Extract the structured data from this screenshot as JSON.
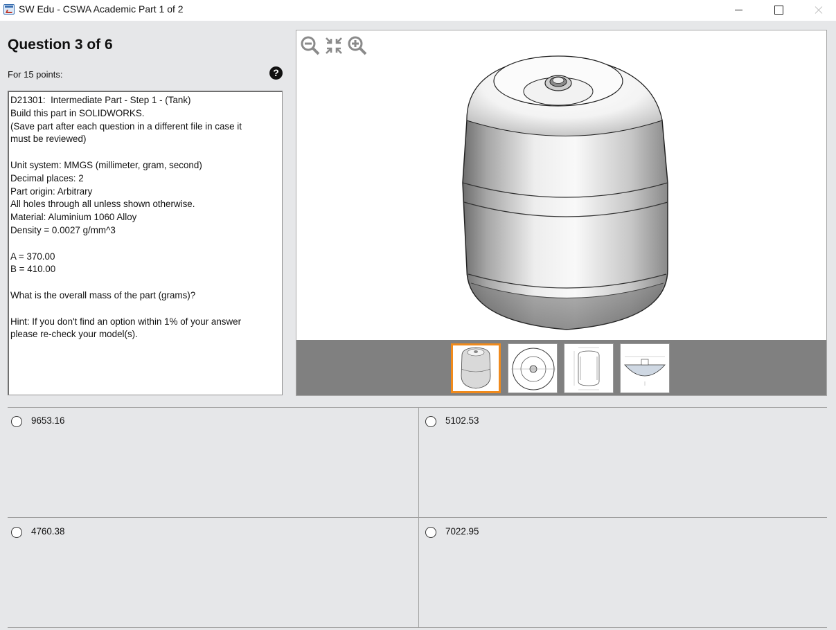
{
  "window": {
    "title": "SW Edu - CSWA Academic Part 1 of 2"
  },
  "question": {
    "header": "Question 3 of 6",
    "points": "For 15 points:",
    "help_glyph": "?",
    "body": "D21301:  Intermediate Part - Step 1 - (Tank)\nBuild this part in SOLIDWORKS.\n(Save part after each question in a different file in case it\nmust be reviewed)\n\nUnit system: MMGS (millimeter, gram, second)\nDecimal places: 2\nPart origin: Arbitrary\nAll holes through all unless shown otherwise.\nMaterial: Aluminium 1060 Alloy\nDensity = 0.0027 g/mm^3\n\nA = 370.00\nB = 410.00\n\nWhat is the overall mass of the part (grams)?\n\nHint: If you don't find an option within 1% of your answer\nplease re-check your model(s)."
  },
  "viewer": {
    "tools": [
      "zoom-out-icon",
      "fit-view-icon",
      "zoom-in-icon"
    ],
    "thumbnails": [
      {
        "icon": "tank-isometric-thumbnail",
        "selected": true
      },
      {
        "icon": "tank-top-view-thumbnail",
        "selected": false
      },
      {
        "icon": "tank-section-drawing-thumbnail",
        "selected": false
      },
      {
        "icon": "tank-detail-drawing-thumbnail",
        "selected": false
      }
    ],
    "colors": {
      "selected_border": "#f08a1c",
      "strip": "#808080"
    }
  },
  "answers": [
    {
      "id": "a",
      "label": "9653.16"
    },
    {
      "id": "b",
      "label": "5102.53"
    },
    {
      "id": "c",
      "label": "4760.38"
    },
    {
      "id": "d",
      "label": "7022.95"
    }
  ]
}
